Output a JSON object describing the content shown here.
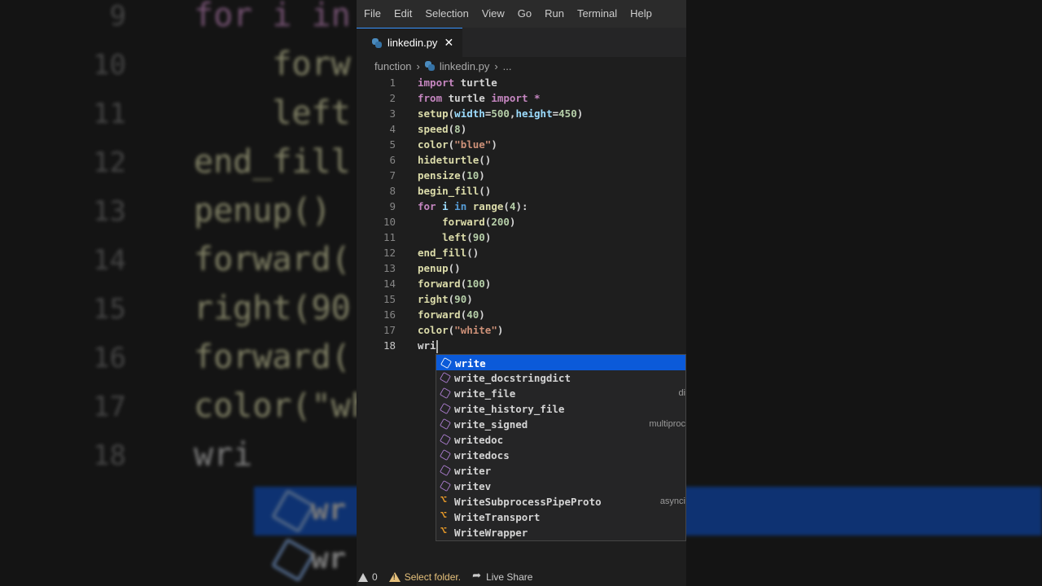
{
  "menu": [
    "File",
    "Edit",
    "Selection",
    "View",
    "Go",
    "Run",
    "Terminal",
    "Help"
  ],
  "tab": {
    "filename": "linkedin.py",
    "close": "✕"
  },
  "breadcrumb": {
    "folder": "function",
    "file": "linkedin.py",
    "more": "..."
  },
  "code_lines": [
    {
      "num": "1",
      "tokens": [
        [
          "k",
          "import"
        ],
        [
          "p",
          " turtle"
        ]
      ]
    },
    {
      "num": "2",
      "tokens": [
        [
          "k",
          "from"
        ],
        [
          "p",
          " turtle "
        ],
        [
          "k",
          "import"
        ],
        [
          "p",
          " "
        ],
        [
          "k",
          "*"
        ]
      ]
    },
    {
      "num": "3",
      "tokens": [
        [
          "f",
          "setup"
        ],
        [
          "p",
          "("
        ],
        [
          "v",
          "width"
        ],
        [
          "p",
          "="
        ],
        [
          "n",
          "500"
        ],
        [
          "p",
          ","
        ],
        [
          "v",
          "height"
        ],
        [
          "p",
          "="
        ],
        [
          "n",
          "450"
        ],
        [
          "p",
          ")"
        ]
      ]
    },
    {
      "num": "4",
      "tokens": [
        [
          "f",
          "speed"
        ],
        [
          "p",
          "("
        ],
        [
          "n",
          "8"
        ],
        [
          "p",
          ")"
        ]
      ]
    },
    {
      "num": "5",
      "tokens": [
        [
          "f",
          "color"
        ],
        [
          "p",
          "("
        ],
        [
          "s",
          "\"blue\""
        ],
        [
          "p",
          ")"
        ]
      ]
    },
    {
      "num": "6",
      "tokens": [
        [
          "f",
          "hideturtle"
        ],
        [
          "p",
          "()"
        ]
      ]
    },
    {
      "num": "7",
      "tokens": [
        [
          "f",
          "pensize"
        ],
        [
          "p",
          "("
        ],
        [
          "n",
          "10"
        ],
        [
          "p",
          ")"
        ]
      ]
    },
    {
      "num": "8",
      "tokens": [
        [
          "f",
          "begin_fill"
        ],
        [
          "p",
          "()"
        ]
      ]
    },
    {
      "num": "9",
      "tokens": [
        [
          "k",
          "for"
        ],
        [
          "p",
          " "
        ],
        [
          "v",
          "i"
        ],
        [
          "p",
          " "
        ],
        [
          "b",
          "in"
        ],
        [
          "p",
          " "
        ],
        [
          "f",
          "range"
        ],
        [
          "p",
          "("
        ],
        [
          "n",
          "4"
        ],
        [
          "p",
          "):"
        ]
      ]
    },
    {
      "num": "10",
      "tokens": [
        [
          "p",
          "    "
        ],
        [
          "f",
          "forward"
        ],
        [
          "p",
          "("
        ],
        [
          "n",
          "200"
        ],
        [
          "p",
          ")"
        ]
      ]
    },
    {
      "num": "11",
      "tokens": [
        [
          "p",
          "    "
        ],
        [
          "f",
          "left"
        ],
        [
          "p",
          "("
        ],
        [
          "n",
          "90"
        ],
        [
          "p",
          ")"
        ]
      ]
    },
    {
      "num": "12",
      "tokens": [
        [
          "f",
          "end_fill"
        ],
        [
          "p",
          "()"
        ]
      ]
    },
    {
      "num": "13",
      "tokens": [
        [
          "f",
          "penup"
        ],
        [
          "p",
          "()"
        ]
      ]
    },
    {
      "num": "14",
      "tokens": [
        [
          "f",
          "forward"
        ],
        [
          "p",
          "("
        ],
        [
          "n",
          "100"
        ],
        [
          "p",
          ")"
        ]
      ]
    },
    {
      "num": "15",
      "tokens": [
        [
          "f",
          "right"
        ],
        [
          "p",
          "("
        ],
        [
          "n",
          "90"
        ],
        [
          "p",
          ")"
        ]
      ]
    },
    {
      "num": "16",
      "tokens": [
        [
          "f",
          "forward"
        ],
        [
          "p",
          "("
        ],
        [
          "n",
          "40"
        ],
        [
          "p",
          ")"
        ]
      ]
    },
    {
      "num": "17",
      "tokens": [
        [
          "f",
          "color"
        ],
        [
          "p",
          "("
        ],
        [
          "s",
          "\"white\""
        ],
        [
          "p",
          ")"
        ]
      ]
    },
    {
      "num": "18",
      "tokens": [
        [
          "p",
          "wri"
        ]
      ],
      "active": true
    }
  ],
  "suggestions": [
    {
      "label": "write",
      "kind": "method",
      "detail": "",
      "selected": true
    },
    {
      "label": "write_docstringdict",
      "kind": "method",
      "detail": ""
    },
    {
      "label": "write_file",
      "kind": "method",
      "detail": "di"
    },
    {
      "label": "write_history_file",
      "kind": "method",
      "detail": ""
    },
    {
      "label": "write_signed",
      "kind": "method",
      "detail": "multiproc"
    },
    {
      "label": "writedoc",
      "kind": "method",
      "detail": ""
    },
    {
      "label": "writedocs",
      "kind": "method",
      "detail": ""
    },
    {
      "label": "writer",
      "kind": "method",
      "detail": ""
    },
    {
      "label": "writev",
      "kind": "method",
      "detail": ""
    },
    {
      "label": "WriteSubprocessPipeProto",
      "kind": "class",
      "detail": "asynci"
    },
    {
      "label": "WriteTransport",
      "kind": "class",
      "detail": ""
    },
    {
      "label": "WriteWrapper",
      "kind": "class",
      "detail": ""
    }
  ],
  "status": {
    "errors": "0",
    "select_folder": "Select folder.",
    "live_share": "Live Share"
  },
  "background": {
    "lines": [
      {
        "num": "9",
        "text": "for i in"
      },
      {
        "num": "10",
        "text": "    forw"
      },
      {
        "num": "11",
        "text": "    left"
      },
      {
        "num": "12",
        "text": "end_fill"
      },
      {
        "num": "13",
        "text": "penup()"
      },
      {
        "num": "14",
        "text": "forward("
      },
      {
        "num": "15",
        "text": "right(90"
      },
      {
        "num": "16",
        "text": "forward("
      },
      {
        "num": "17",
        "text": "color(\"wh"
      },
      {
        "num": "18",
        "text": "wri"
      }
    ],
    "suggest": [
      "wr",
      "wr"
    ]
  },
  "colors": {
    "accent": "#0b5ad9",
    "editor_bg": "#1e1e1e",
    "keyword": "#c586c0",
    "function": "#dcdcaa",
    "number": "#b5cea8",
    "string": "#ce9178"
  }
}
